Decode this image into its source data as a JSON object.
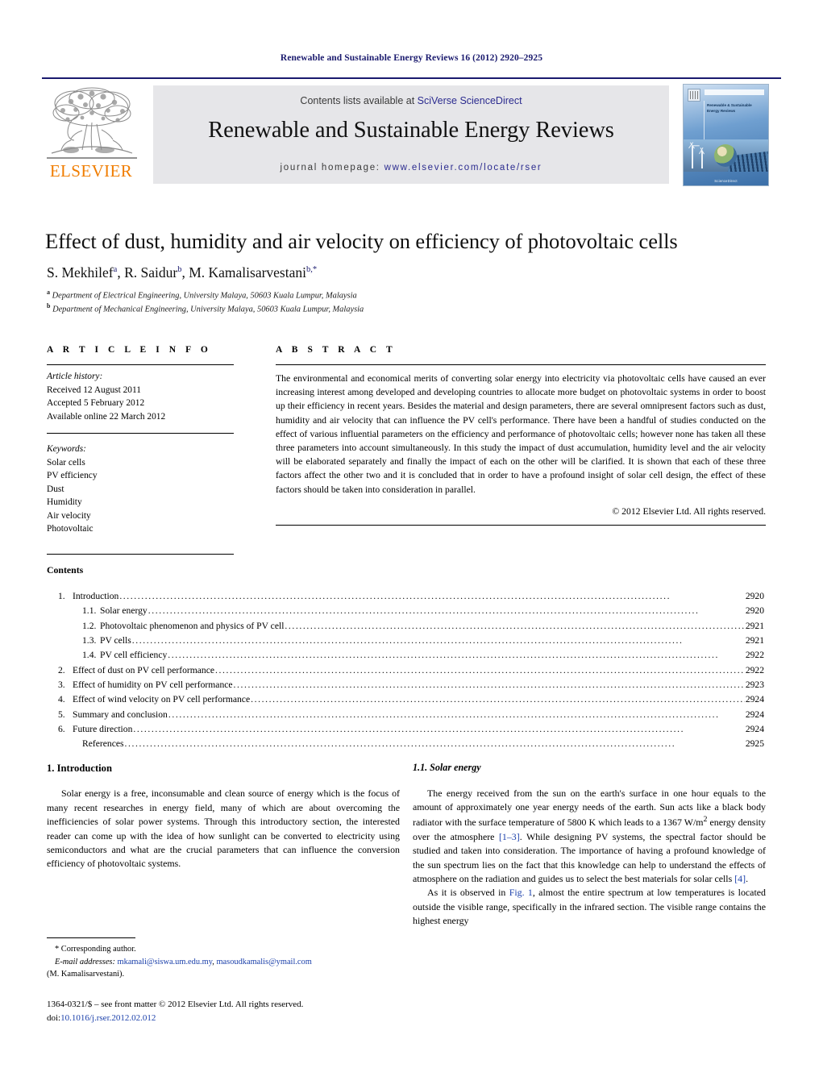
{
  "running_head": "Renewable and Sustainable Energy Reviews 16 (2012) 2920–2925",
  "masthead": {
    "publisher_wordmark": "ELSEVIER",
    "contents_prefix": "Contents lists available at ",
    "contents_link": "SciVerse ScienceDirect",
    "journal_title": "Renewable and Sustainable Energy Reviews",
    "homepage_prefix": "journal homepage: ",
    "homepage_url": "www.elsevier.com/locate/rser",
    "cover": {
      "title_lines": "Renewable & Sustainable Energy Reviews",
      "caption": "ScienceDirect"
    },
    "colors": {
      "rule": "#1a1a6e",
      "band": "#e6e6e9",
      "link": "#2b2b8f",
      "wordmark": "#f07d00"
    }
  },
  "article": {
    "title": "Effect of dust, humidity and air velocity on efficiency of photovoltaic cells",
    "authors": "S. Mekhilef",
    "authors_full": [
      {
        "name": "S. Mekhilef",
        "marks": "a"
      },
      {
        "name": "R. Saidur",
        "marks": "b"
      },
      {
        "name": "M. Kamalisarvestani",
        "marks": "b,*"
      }
    ],
    "affiliations": [
      {
        "mark": "a",
        "text": "Department of Electrical Engineering, University Malaya, 50603 Kuala Lumpur, Malaysia"
      },
      {
        "mark": "b",
        "text": "Department of Mechanical Engineering, University Malaya, 50603 Kuala Lumpur, Malaysia"
      }
    ]
  },
  "article_info": {
    "heading": "A R T I C L E  I N F O",
    "history_label": "Article history:",
    "history": [
      "Received 12 August 2011",
      "Accepted 5 February 2012",
      "Available online 22 March 2012"
    ],
    "keywords_label": "Keywords:",
    "keywords": [
      "Solar cells",
      "PV efficiency",
      "Dust",
      "Humidity",
      "Air velocity",
      "Photovoltaic"
    ]
  },
  "abstract": {
    "heading": "A B S T R A C T",
    "text": "The environmental and economical merits of converting solar energy into electricity via photovoltaic cells have caused an ever increasing interest among developed and developing countries to allocate more budget on photovoltaic systems in order to boost up their efficiency in recent years. Besides the material and design parameters, there are several omnipresent factors such as dust, humidity and air velocity that can influence the PV cell's performance. There have been a handful of studies conducted on the effect of various influential parameters on the efficiency and performance of photovoltaic cells; however none has taken all these three parameters into account simultaneously. In this study the impact of dust accumulation, humidity level and the air velocity will be elaborated separately and finally the impact of each on the other will be clarified. It is shown that each of these three factors affect the other two and it is concluded that in order to have a profound insight of solar cell design, the effect of these factors should be taken into consideration in parallel.",
    "copyright": "© 2012 Elsevier Ltd. All rights reserved."
  },
  "contents": {
    "heading": "Contents",
    "entries": [
      {
        "num": "1.",
        "label": "Introduction",
        "page": "2920",
        "level": 1
      },
      {
        "num": "1.1.",
        "label": "Solar energy",
        "page": "2920",
        "level": 2
      },
      {
        "num": "1.2.",
        "label": "Photovoltaic phenomenon and physics of PV cell",
        "page": "2921",
        "level": 2
      },
      {
        "num": "1.3.",
        "label": "PV cells",
        "page": "2921",
        "level": 2
      },
      {
        "num": "1.4.",
        "label": "PV cell efficiency",
        "page": "2922",
        "level": 2
      },
      {
        "num": "2.",
        "label": "Effect of dust on PV cell performance",
        "page": "2922",
        "level": 1
      },
      {
        "num": "3.",
        "label": "Effect of humidity on PV cell performance",
        "page": "2923",
        "level": 1
      },
      {
        "num": "4.",
        "label": "Effect of wind velocity on PV cell performance",
        "page": "2924",
        "level": 1
      },
      {
        "num": "5.",
        "label": "Summary and conclusion",
        "page": "2924",
        "level": 1
      },
      {
        "num": "6.",
        "label": "Future direction",
        "page": "2924",
        "level": 1
      },
      {
        "num": "",
        "label": "References",
        "page": "2925",
        "level": 3
      }
    ]
  },
  "body": {
    "left": {
      "section_heading": "1.  Introduction",
      "paragraph_1": "Solar energy is a free, inconsumable and clean source of energy which is the focus of many recent researches in energy field, many of which are about overcoming the inefficiencies of solar power systems. Through this introductory section, the interested reader can come up with the idea of how sunlight can be converted to electricity using semiconductors and what are the crucial parameters that can influence the conversion efficiency of photovoltaic systems."
    },
    "right": {
      "section_heading": "1.1.  Solar energy",
      "paragraph_1_a": "The energy received from the sun on the earth's surface in one hour equals to the amount of approximately one year energy needs of the earth. Sun acts like a black body radiator with the surface temperature of 5800 K which leads to a 1367 W/m",
      "paragraph_1_sup": "2",
      "paragraph_1_b": " energy density over the atmosphere ",
      "citation_1": "[1–3]",
      "paragraph_1_c": ". While designing PV systems, the spectral factor should be studied and taken into consideration. The importance of having a profound knowledge of the sun spectrum lies on the fact that this knowledge can help to understand the effects of atmosphere on the radiation and guides us to select the best materials for solar cells ",
      "citation_2": "[4]",
      "paragraph_1_d": ".",
      "paragraph_2_a": "As it is observed in ",
      "figure_ref": "Fig. 1",
      "paragraph_2_b": ", almost the entire spectrum at low temperatures is located outside the visible range, specifically in the infrared section. The visible range contains the highest energy"
    }
  },
  "footnotes": {
    "corresponding": "* Corresponding author.",
    "email_label": "E-mail addresses:",
    "email_1": "mkamali@siswa.um.edu.my",
    "email_2": "masoudkamalis@ymail.com",
    "email_owner": "(M. Kamalisarvestani).",
    "imprint_line_1": "1364-0321/$ – see front matter © 2012 Elsevier Ltd. All rights reserved.",
    "imprint_doi_label": "doi:",
    "imprint_doi": "10.1016/j.rser.2012.02.012"
  }
}
